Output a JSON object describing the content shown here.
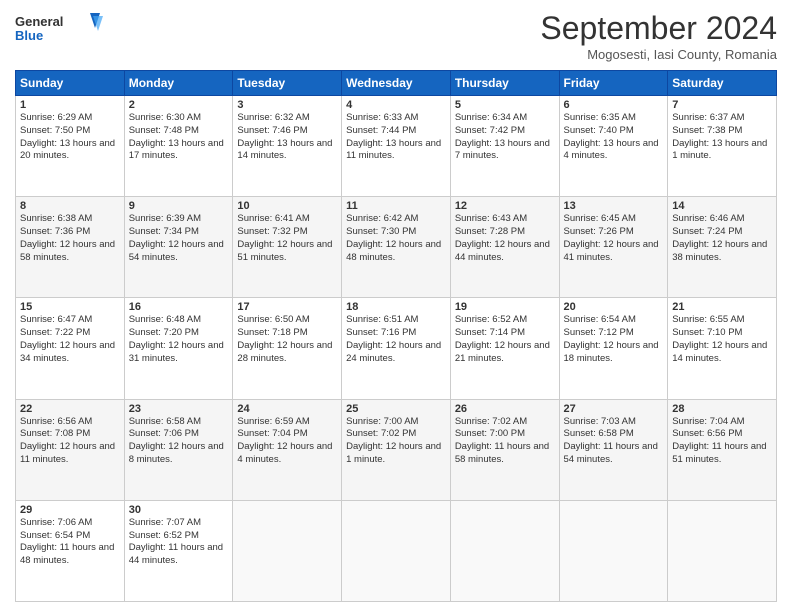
{
  "header": {
    "logo_general": "General",
    "logo_blue": "Blue",
    "month_title": "September 2024",
    "location": "Mogosesti, Iasi County, Romania"
  },
  "weekdays": [
    "Sunday",
    "Monday",
    "Tuesday",
    "Wednesday",
    "Thursday",
    "Friday",
    "Saturday"
  ],
  "weeks": [
    [
      {
        "day": "1",
        "sunrise": "6:29 AM",
        "sunset": "7:50 PM",
        "daylight": "13 hours and 20 minutes."
      },
      {
        "day": "2",
        "sunrise": "6:30 AM",
        "sunset": "7:48 PM",
        "daylight": "13 hours and 17 minutes."
      },
      {
        "day": "3",
        "sunrise": "6:32 AM",
        "sunset": "7:46 PM",
        "daylight": "13 hours and 14 minutes."
      },
      {
        "day": "4",
        "sunrise": "6:33 AM",
        "sunset": "7:44 PM",
        "daylight": "13 hours and 11 minutes."
      },
      {
        "day": "5",
        "sunrise": "6:34 AM",
        "sunset": "7:42 PM",
        "daylight": "13 hours and 7 minutes."
      },
      {
        "day": "6",
        "sunrise": "6:35 AM",
        "sunset": "7:40 PM",
        "daylight": "13 hours and 4 minutes."
      },
      {
        "day": "7",
        "sunrise": "6:37 AM",
        "sunset": "7:38 PM",
        "daylight": "13 hours and 1 minute."
      }
    ],
    [
      {
        "day": "8",
        "sunrise": "6:38 AM",
        "sunset": "7:36 PM",
        "daylight": "12 hours and 58 minutes."
      },
      {
        "day": "9",
        "sunrise": "6:39 AM",
        "sunset": "7:34 PM",
        "daylight": "12 hours and 54 minutes."
      },
      {
        "day": "10",
        "sunrise": "6:41 AM",
        "sunset": "7:32 PM",
        "daylight": "12 hours and 51 minutes."
      },
      {
        "day": "11",
        "sunrise": "6:42 AM",
        "sunset": "7:30 PM",
        "daylight": "12 hours and 48 minutes."
      },
      {
        "day": "12",
        "sunrise": "6:43 AM",
        "sunset": "7:28 PM",
        "daylight": "12 hours and 44 minutes."
      },
      {
        "day": "13",
        "sunrise": "6:45 AM",
        "sunset": "7:26 PM",
        "daylight": "12 hours and 41 minutes."
      },
      {
        "day": "14",
        "sunrise": "6:46 AM",
        "sunset": "7:24 PM",
        "daylight": "12 hours and 38 minutes."
      }
    ],
    [
      {
        "day": "15",
        "sunrise": "6:47 AM",
        "sunset": "7:22 PM",
        "daylight": "12 hours and 34 minutes."
      },
      {
        "day": "16",
        "sunrise": "6:48 AM",
        "sunset": "7:20 PM",
        "daylight": "12 hours and 31 minutes."
      },
      {
        "day": "17",
        "sunrise": "6:50 AM",
        "sunset": "7:18 PM",
        "daylight": "12 hours and 28 minutes."
      },
      {
        "day": "18",
        "sunrise": "6:51 AM",
        "sunset": "7:16 PM",
        "daylight": "12 hours and 24 minutes."
      },
      {
        "day": "19",
        "sunrise": "6:52 AM",
        "sunset": "7:14 PM",
        "daylight": "12 hours and 21 minutes."
      },
      {
        "day": "20",
        "sunrise": "6:54 AM",
        "sunset": "7:12 PM",
        "daylight": "12 hours and 18 minutes."
      },
      {
        "day": "21",
        "sunrise": "6:55 AM",
        "sunset": "7:10 PM",
        "daylight": "12 hours and 14 minutes."
      }
    ],
    [
      {
        "day": "22",
        "sunrise": "6:56 AM",
        "sunset": "7:08 PM",
        "daylight": "12 hours and 11 minutes."
      },
      {
        "day": "23",
        "sunrise": "6:58 AM",
        "sunset": "7:06 PM",
        "daylight": "12 hours and 8 minutes."
      },
      {
        "day": "24",
        "sunrise": "6:59 AM",
        "sunset": "7:04 PM",
        "daylight": "12 hours and 4 minutes."
      },
      {
        "day": "25",
        "sunrise": "7:00 AM",
        "sunset": "7:02 PM",
        "daylight": "12 hours and 1 minute."
      },
      {
        "day": "26",
        "sunrise": "7:02 AM",
        "sunset": "7:00 PM",
        "daylight": "11 hours and 58 minutes."
      },
      {
        "day": "27",
        "sunrise": "7:03 AM",
        "sunset": "6:58 PM",
        "daylight": "11 hours and 54 minutes."
      },
      {
        "day": "28",
        "sunrise": "7:04 AM",
        "sunset": "6:56 PM",
        "daylight": "11 hours and 51 minutes."
      }
    ],
    [
      {
        "day": "29",
        "sunrise": "7:06 AM",
        "sunset": "6:54 PM",
        "daylight": "11 hours and 48 minutes."
      },
      {
        "day": "30",
        "sunrise": "7:07 AM",
        "sunset": "6:52 PM",
        "daylight": "11 hours and 44 minutes."
      },
      null,
      null,
      null,
      null,
      null
    ]
  ],
  "labels": {
    "sunrise": "Sunrise:",
    "sunset": "Sunset:",
    "daylight": "Daylight:"
  }
}
